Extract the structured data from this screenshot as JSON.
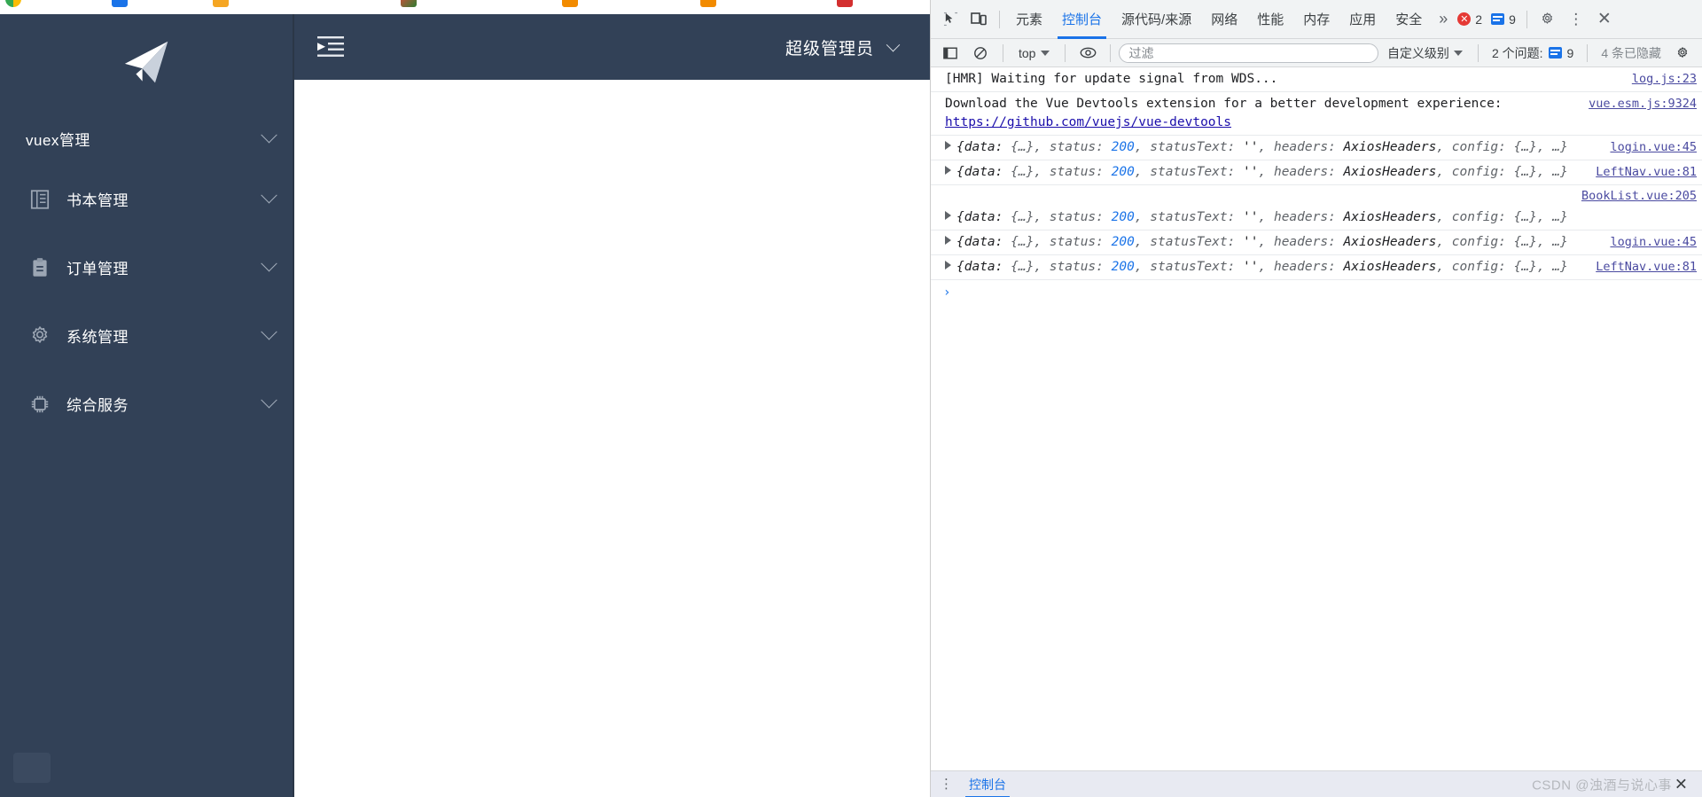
{
  "browser": {
    "favicons": [
      "#e8493a",
      "#1a73e8",
      "#f5a623",
      "#2e7d32",
      "#e8691a",
      "#f28b00",
      "#d32f2f"
    ]
  },
  "app": {
    "logo_icon": "paper-plane-icon",
    "sidebar": {
      "root_label": "vuex管理",
      "items": [
        {
          "label": "书本管理",
          "icon": "book-icon"
        },
        {
          "label": "订单管理",
          "icon": "clipboard-icon"
        },
        {
          "label": "系统管理",
          "icon": "gear-icon"
        },
        {
          "label": "综合服务",
          "icon": "chip-icon"
        }
      ]
    },
    "topbar": {
      "fold_icon": "collapse-menu-icon",
      "username": "超级管理员",
      "user_caret_icon": "chevron-down-icon"
    },
    "colors": {
      "sidebar_bg": "#324157",
      "topbar_bg": "#324157"
    }
  },
  "devtools": {
    "toolbar_icons": {
      "inspect": "inspect-element-icon",
      "device": "device-toolbar-icon",
      "sidebar_toggle": "console-sidebar-icon",
      "clear": "clear-console-icon",
      "eye": "live-expression-icon",
      "settings": "gear-icon",
      "kebab": "more-options-icon",
      "close": "close-icon"
    },
    "tabs": [
      {
        "label": "元素",
        "active": false
      },
      {
        "label": "控制台",
        "active": true
      },
      {
        "label": "源代码/来源",
        "active": false
      },
      {
        "label": "网络",
        "active": false
      },
      {
        "label": "性能",
        "active": false
      },
      {
        "label": "内存",
        "active": false
      },
      {
        "label": "应用",
        "active": false
      },
      {
        "label": "安全",
        "active": false
      }
    ],
    "overflow_label": "»",
    "error_count": "2",
    "message_count": "9",
    "console_toolbar": {
      "context": "top",
      "filter_placeholder": "过滤",
      "filter_value": "",
      "levels_label": "自定义级别",
      "issues_label": "2 个问题:",
      "issues_count": "9",
      "hidden_label": "4 条已隐藏"
    },
    "logs": [
      {
        "type": "text",
        "message": "[HMR] Waiting for update signal from WDS...",
        "source": "log.js:23"
      },
      {
        "type": "text-link",
        "message": "Download the Vue Devtools extension for a better development experience:",
        "link": "https://github.com/vuejs/vue-devtools",
        "source": "vue.esm.js:9324"
      },
      {
        "type": "object",
        "prefix": "{data: ",
        "data_val": "{…}",
        "status_key": ", status: ",
        "status_val": "200",
        "statustext_key": ", statusText: ",
        "statustext_val": "''",
        "headers_key": ", headers: ",
        "headers_val": "AxiosHeaders",
        "config_key": ", config: ",
        "config_val": "{…}",
        "suffix": ", …}",
        "source": "login.vue:45"
      },
      {
        "type": "object",
        "prefix": "{data: ",
        "data_val": "{…}",
        "status_key": ", status: ",
        "status_val": "200",
        "statustext_key": ", statusText: ",
        "statustext_val": "''",
        "headers_key": ", headers: ",
        "headers_val": "AxiosHeaders",
        "config_key": ", config: ",
        "config_val": "{…}",
        "suffix": ", …}",
        "source": "LeftNav.vue:81"
      },
      {
        "type": "object",
        "prefix": "{data: ",
        "data_val": "{…}",
        "status_key": ", status: ",
        "status_val": "200",
        "statustext_key": ", statusText: ",
        "statustext_val": "''",
        "headers_key": ", headers: ",
        "headers_val": "AxiosHeaders",
        "config_key": ", config: ",
        "config_val": "{…}",
        "suffix": ", …}",
        "source": "BookList.vue:205",
        "source_above": true
      },
      {
        "type": "object",
        "prefix": "{data: ",
        "data_val": "{…}",
        "status_key": ", status: ",
        "status_val": "200",
        "statustext_key": ", statusText: ",
        "statustext_val": "''",
        "headers_key": ", headers: ",
        "headers_val": "AxiosHeaders",
        "config_key": ", config: ",
        "config_val": "{…}",
        "suffix": ", …}",
        "source": "login.vue:45"
      },
      {
        "type": "object",
        "prefix": "{data: ",
        "data_val": "{…}",
        "status_key": ", status: ",
        "status_val": "200",
        "statustext_key": ", statusText: ",
        "statustext_val": "''",
        "headers_key": ", headers: ",
        "headers_val": "AxiosHeaders",
        "config_key": ", config: ",
        "config_val": "{…}",
        "suffix": ", …}",
        "source": "LeftNav.vue:81"
      }
    ],
    "prompt_symbol": "›",
    "statusbar": {
      "drawer_tab": "控制台",
      "watermark": "CSDN @浊酒与说心事"
    }
  }
}
